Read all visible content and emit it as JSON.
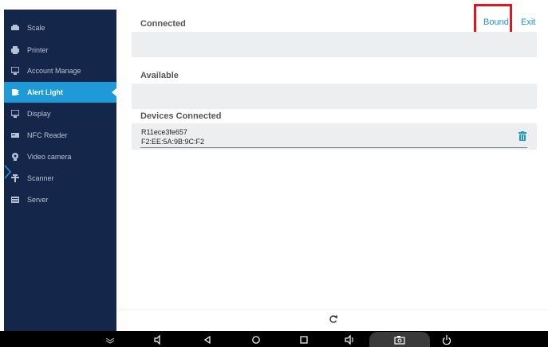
{
  "sidebar": {
    "items": [
      {
        "label": "Scale",
        "icon": "scale-icon"
      },
      {
        "label": "Printer",
        "icon": "printer-icon"
      },
      {
        "label": "Account Manage",
        "icon": "account-icon"
      },
      {
        "label": "Alert Light",
        "icon": "alert-light-icon",
        "active": true
      },
      {
        "label": "Display",
        "icon": "display-icon"
      },
      {
        "label": "NFC Reader",
        "icon": "nfc-icon"
      },
      {
        "label": "Video camera",
        "icon": "camera-icon"
      },
      {
        "label": "Scanner",
        "icon": "scanner-icon"
      },
      {
        "label": "Server",
        "icon": "server-icon"
      }
    ]
  },
  "header": {
    "bound_label": "Bound",
    "exit_label": "Exit"
  },
  "sections": {
    "connected": "Connected",
    "available": "Available",
    "devices_connected": "Devices Connected"
  },
  "device": {
    "name": "R11ece3fe657",
    "mac": "F2:EE:5A:9B:9C:F2"
  },
  "colors": {
    "sidebar_bg": "#14274a",
    "accent": "#1a97d6",
    "highlight": "#e4151d"
  }
}
